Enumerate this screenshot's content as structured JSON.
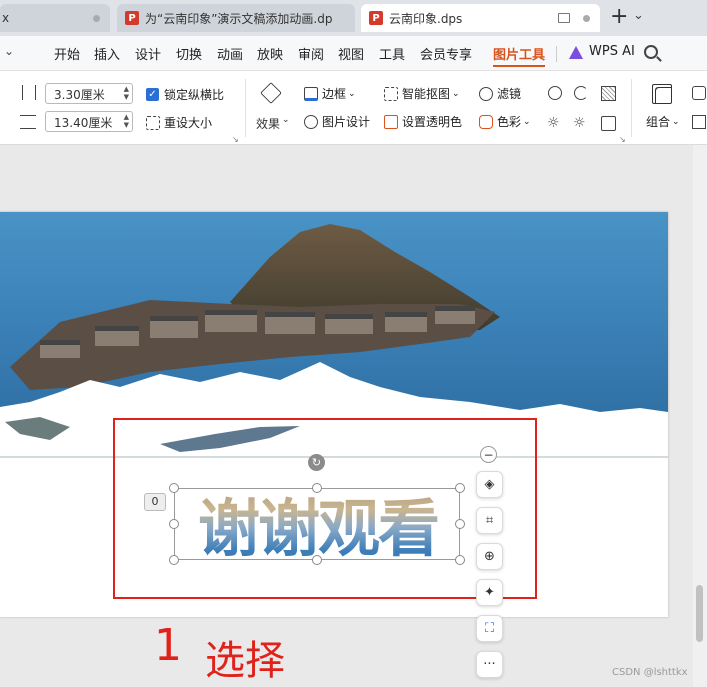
{
  "tabs": [
    {
      "label": "x"
    },
    {
      "label": "为“云南印象”演示文稿添加动画.dp"
    },
    {
      "label": "云南印象.dps"
    }
  ],
  "tab_bar": {
    "new_tab": "+",
    "dropdown": "⌄"
  },
  "menu": {
    "items": [
      "开始",
      "插入",
      "设计",
      "切换",
      "动画",
      "放映",
      "审阅",
      "视图",
      "工具",
      "会员专享",
      "图片工具"
    ],
    "active": "图片工具",
    "wps_ai": "WPS AI"
  },
  "ribbon": {
    "height_value": "3.30厘米",
    "width_value": "13.40厘米",
    "lock_ratio": "锁定纵横比",
    "reset_size": "重设大小",
    "effects": "效果",
    "border": "边框",
    "picture_design": "图片设计",
    "smart_cutout": "智能抠图",
    "set_transparent": "设置透明色",
    "filter": "滤镜",
    "color": "色彩",
    "group": "组合"
  },
  "slide": {
    "wordart_text": "谢谢观看",
    "badge": "0"
  },
  "annotation": {
    "number": "1",
    "text": "选择"
  },
  "watermark": "CSDN @lshttkx",
  "colors": {
    "accent": "#d9531e",
    "annotation": "#e0221b",
    "ppt_icon": "#d33a2c"
  }
}
